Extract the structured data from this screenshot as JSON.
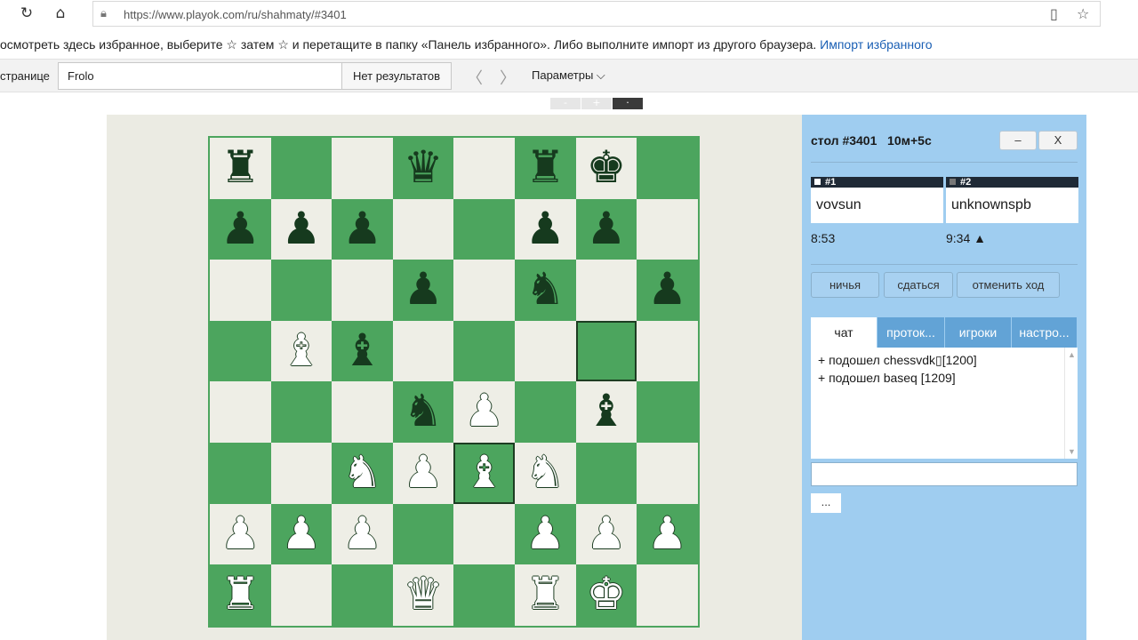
{
  "browser": {
    "url": "https://www.playok.com/ru/shahmaty/#3401",
    "favorites_text": "осмотреть здесь избранное, выберите ☆ затем ☆ и перетащите в папку «Панель избранного». Либо выполните импорт из другого браузера.",
    "favorites_link": "Импорт избранного",
    "find_label": "странице",
    "find_value": "Frolo",
    "find_result": "Нет результатов",
    "params_label": "Параметры ⌵"
  },
  "zoom": [
    "-",
    "+",
    "·"
  ],
  "table": {
    "title": "стол #3401",
    "time_control": "10м+5с",
    "minimize_label": "–",
    "close_label": "X"
  },
  "players": [
    {
      "seat": "#1",
      "name": "vovsun",
      "clock": "8:53"
    },
    {
      "seat": "#2",
      "name": "unknownspb",
      "clock": "9:34 ▲"
    }
  ],
  "actions": {
    "draw": "ничья",
    "resign": "сдаться",
    "undo": "отменить ход"
  },
  "tabs": [
    "чат",
    "проток...",
    "игроки",
    "настро..."
  ],
  "chat": [
    "+ подошел chessvdk\u0000[1200]",
    "+ подошел baseq [1209]"
  ],
  "more_label": "...",
  "board": {
    "rows": [
      [
        "br",
        "",
        "",
        "bq",
        "",
        "br",
        "bk",
        ""
      ],
      [
        "bp",
        "bp",
        "bp",
        "",
        "",
        "bp",
        "bp",
        ""
      ],
      [
        "",
        "",
        "",
        "bp",
        "",
        "bn",
        "",
        "bp"
      ],
      [
        "",
        "wb",
        "bb",
        "",
        "",
        "",
        "",
        ""
      ],
      [
        "",
        "",
        "",
        "bn",
        "wp",
        "",
        "bb",
        ""
      ],
      [
        "",
        "",
        "wn",
        "wp",
        "wb",
        "wn",
        "",
        ""
      ],
      [
        "wp",
        "wp",
        "wp",
        "",
        "",
        "wp",
        "wp",
        "wp"
      ],
      [
        "wr",
        "",
        "",
        "wq",
        "",
        "wr",
        "wk",
        ""
      ]
    ],
    "highlight": [
      [
        3,
        6
      ],
      [
        5,
        4
      ]
    ]
  }
}
